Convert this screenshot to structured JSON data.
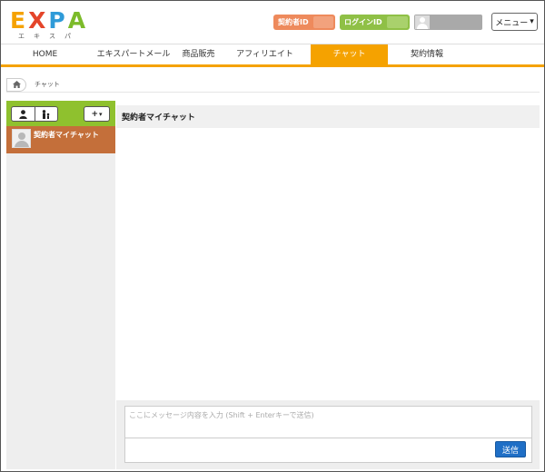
{
  "logo": {
    "letters": [
      {
        "char": "E",
        "color": "#f5a200"
      },
      {
        "char": "X",
        "color": "#e4452a"
      },
      {
        "char": "P",
        "color": "#2f9bd8"
      },
      {
        "char": "A",
        "color": "#7cbb2a"
      }
    ],
    "subtitle": [
      "エ",
      "キ",
      "ス",
      "パ"
    ]
  },
  "header": {
    "contract_id_label": "契約者ID",
    "login_id_label": "ログインID",
    "menu_label": "メニュー",
    "menu_caret": "▾"
  },
  "nav": {
    "items": [
      {
        "label": "HOME",
        "active": false
      },
      {
        "label": "エキスパートメール",
        "active": false
      },
      {
        "label": "商品販売",
        "active": false
      },
      {
        "label": "アフィリエイト",
        "active": false
      },
      {
        "label": "チャット",
        "active": true
      },
      {
        "label": "契約情報",
        "active": false
      }
    ]
  },
  "breadcrumb": {
    "home_icon": "home-icon",
    "current": "チャット"
  },
  "sidebar": {
    "add_label": "+",
    "add_caret": "▾",
    "rooms": [
      {
        "name": "契約者マイチャット",
        "selected": true
      }
    ]
  },
  "chat": {
    "title": "契約者マイチャット",
    "input_placeholder": "ここにメッセージ内容を入力 (Shift + Enterキーで送信)",
    "send_label": "送信"
  },
  "colors": {
    "accent_orange": "#f5a200",
    "sidebar_green": "#8fc12e",
    "room_selected": "#c46f3a",
    "send_blue": "#1f6fc6"
  }
}
